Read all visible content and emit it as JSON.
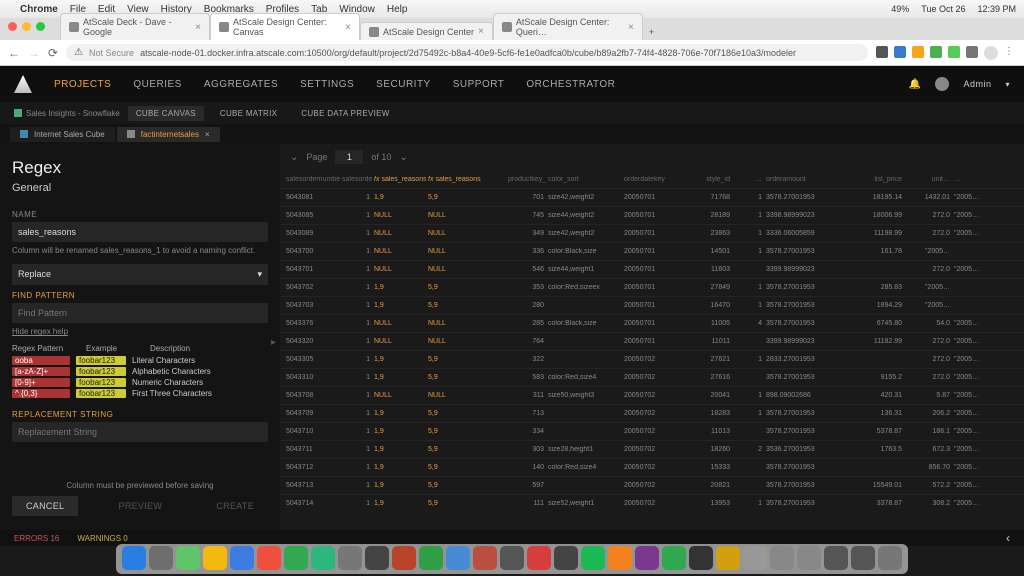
{
  "menubar": {
    "app": "Chrome",
    "items": [
      "File",
      "Edit",
      "View",
      "History",
      "Bookmarks",
      "Profiles",
      "Tab",
      "Window",
      "Help"
    ],
    "right": [
      "🔋",
      "🔒",
      "🛜",
      "49%",
      "Tue Oct 26",
      "12:39 PM"
    ]
  },
  "browser": {
    "tabs": [
      {
        "title": "AtScale Deck - Dave - Google"
      },
      {
        "title": "AtScale Design Center: Canvas",
        "active": true
      },
      {
        "title": "AtScale Design Center"
      },
      {
        "title": "AtScale Design Center: Queri…"
      }
    ],
    "insecure": "Not Secure",
    "url": "atscale-node-01.docker.infra.atscale.com:10500/org/default/project/2d75492c-b8a4-40e9-5cf6-fe1e0adfca0b/cube/b89a2fb7-74f4-4828-706e-70f7186e10a3/modeler",
    "ext_colors": [
      "#555",
      "#3b7bd6",
      "#f7a41d",
      "#4caf50",
      "#5c5",
      "#777"
    ]
  },
  "header": {
    "nav": [
      "PROJECTS",
      "QUERIES",
      "AGGREGATES",
      "SETTINGS",
      "SECURITY",
      "SUPPORT",
      "ORCHESTRATOR"
    ],
    "active": "PROJECTS",
    "user": "Admin"
  },
  "subtabs": {
    "crumb": "Sales Insights - Snowflake",
    "tabs": [
      "CUBE CANVAS",
      "CUBE MATRIX",
      "CUBE DATA PREVIEW"
    ],
    "active": "CUBE CANVAS"
  },
  "cubetabs": {
    "tabs": [
      {
        "label": "Internet Sales Cube"
      },
      {
        "label": "factinternetsales",
        "active": true
      }
    ]
  },
  "panel": {
    "title": "Regex",
    "subtitle": "General",
    "name_label": "NAME",
    "name_value": "sales_reasons",
    "conflict_note": "Column will be renamed sales_reasons_1 to avoid a naming conflict.",
    "action": "Replace",
    "find_label": "FIND PATTERN",
    "find_placeholder": "Find Pattern",
    "hide_help": "Hide regex help",
    "help_hdr": [
      "Regex Pattern",
      "Example",
      "Description"
    ],
    "help_rows": [
      {
        "pat": "ooba",
        "ex": "foobar123",
        "desc": "Literal Characters"
      },
      {
        "pat": "[a-zA-Z]+",
        "ex": "foobar123",
        "desc": "Alphabetic Characters"
      },
      {
        "pat": "[0-9]+",
        "ex": "foobar123",
        "desc": "Numeric Characters"
      },
      {
        "pat": "^.{0,3}",
        "ex": "foobar123",
        "desc": "First Three Characters"
      }
    ],
    "repl_label": "REPLACEMENT STRING",
    "repl_placeholder": "Replacement String",
    "save_note": "Column must be previewed before saving",
    "cancel": "CANCEL",
    "preview": "PREVIEW",
    "create": "CREATE"
  },
  "pager": {
    "label": "Page",
    "page": "1",
    "of": "of 10"
  },
  "columns": [
    "salesordernumber",
    "salesorderlinenumber",
    "sales_reasons (1)",
    "sales_reasons",
    "productkey_sort",
    "color_sort",
    "orderdatekey",
    "style_id",
    "…",
    "orderamount",
    "list_price",
    "unit…",
    "…"
  ],
  "rows": [
    {
      "c": [
        "5043081",
        "1",
        "1,9",
        "5,9",
        "701",
        "size42,weight2",
        "20050701",
        "71768",
        "1",
        "3578.27001953",
        "18195.14",
        "1432.01",
        "\"2005…"
      ]
    },
    {
      "c": [
        "5043085",
        "1",
        "NULL",
        "NULL",
        "745",
        "size44,weight2",
        "20050701",
        "28189",
        "1",
        "3398.98999023",
        "18006.99",
        "272.0",
        "\"2005…"
      ]
    },
    {
      "c": [
        "5043089",
        "1",
        "NULL",
        "NULL",
        "349",
        "size42,weight2",
        "20050701",
        "23863",
        "1",
        "3336.06005859",
        "11198.99",
        "272.0",
        "\"2005…"
      ]
    },
    {
      "c": [
        "5043700",
        "1",
        "NULL",
        "NULL",
        "336",
        "color:Black,size",
        "20050701",
        "14501",
        "1",
        "3578.27001953",
        "161.78",
        "\"2005…"
      ]
    },
    {
      "c": [
        "5043701",
        "1",
        "NULL",
        "NULL",
        "546",
        "size44,weight1",
        "20050701",
        "11603",
        "",
        "3399.98999023",
        "",
        "272.0",
        "\"2005…"
      ]
    },
    {
      "c": [
        "5043702",
        "1",
        "1,9",
        "5,9",
        "353",
        "color:Red,sizeex",
        "20050701",
        "27849",
        "1",
        "3578.27001953",
        "285.83",
        "\"2005…"
      ]
    },
    {
      "c": [
        "5043703",
        "1",
        "1,9",
        "5,9",
        "280",
        "",
        "20050701",
        "16470",
        "1",
        "3578.27001953",
        "1894.29",
        "\"2005…"
      ]
    },
    {
      "c": [
        "5043376",
        "1",
        "NULL",
        "NULL",
        "285",
        "color:Black,size",
        "20050701",
        "11005",
        "4",
        "3578.27001953",
        "6745.80",
        "54.0",
        "\"2005…"
      ]
    },
    {
      "c": [
        "5043320",
        "1",
        "NULL",
        "NULL",
        "764",
        "",
        "20050701",
        "11011",
        "",
        "3399.98999023",
        "11182.99",
        "272.0",
        "\"2005…"
      ]
    },
    {
      "c": [
        "5043305",
        "1",
        "1,9",
        "5,9",
        "322",
        "",
        "20050702",
        "27621",
        "1",
        "2833.27001953",
        "",
        "272.0",
        "\"2005…"
      ]
    },
    {
      "c": [
        "5043310",
        "1",
        "1,9",
        "5,9",
        "583",
        "color:Red,size4",
        "20050702",
        "27616",
        "",
        "3578.27001953",
        "9155.2",
        "272.0",
        "\"2005…"
      ]
    },
    {
      "c": [
        "5043708",
        "1",
        "NULL",
        "NULL",
        "311",
        "size50,weight3",
        "20050702",
        "20041",
        "1",
        "898.09002686",
        "420.31",
        "5.87",
        "\"2005…"
      ]
    },
    {
      "c": [
        "5043709",
        "1",
        "1,9",
        "5,9",
        "713",
        "",
        "20050702",
        "18283",
        "1",
        "3578.27001953",
        "136.31",
        "206.2",
        "\"2005…"
      ]
    },
    {
      "c": [
        "5043710",
        "1",
        "1,9",
        "5,9",
        "334",
        "",
        "20050702",
        "11013",
        "",
        "3578.27001953",
        "5378.87",
        "186.1",
        "\"2005…"
      ]
    },
    {
      "c": [
        "5043711",
        "1",
        "1,9",
        "5,9",
        "303",
        "size28,height1",
        "20050702",
        "18260",
        "2",
        "3536.27001953",
        "1763.5",
        "672.3",
        "\"2005…"
      ]
    },
    {
      "c": [
        "5043712",
        "1",
        "1,9",
        "5,9",
        "140",
        "color:Red,size4",
        "20050702",
        "15333",
        "",
        "3578.27001953",
        "",
        "856.70",
        "\"2005…"
      ]
    },
    {
      "c": [
        "5043713",
        "1",
        "1,9",
        "5,9",
        "597",
        "",
        "20050702",
        "20821",
        "",
        "3578.27001953",
        "15549.01",
        "572.2",
        "\"2005…"
      ]
    },
    {
      "c": [
        "5043714",
        "1",
        "1,9",
        "5,9",
        "111",
        "size52,weight1",
        "20050702",
        "13953",
        "1",
        "3578.27001953",
        "3378.87",
        "308.2",
        "\"2005…"
      ]
    }
  ],
  "status": {
    "errors": "ERRORS 16",
    "warnings": "WARNINGS 0"
  },
  "dock_colors": [
    "#2a7de1",
    "#6e6e6e",
    "#5fc56a",
    "#f2b90f",
    "#3d7be0",
    "#f04f3e",
    "#33a852",
    "#2db67d",
    "#777",
    "#444",
    "#b8442c",
    "#2f9e44",
    "#478bd6",
    "#b84f40",
    "#555",
    "#d63e3e",
    "#444",
    "#1db954",
    "#f58220",
    "#7a398f",
    "#2fa84f",
    "#333",
    "#d0a010",
    "#999",
    "#888",
    "#888",
    "#555",
    "#555",
    "#777"
  ]
}
